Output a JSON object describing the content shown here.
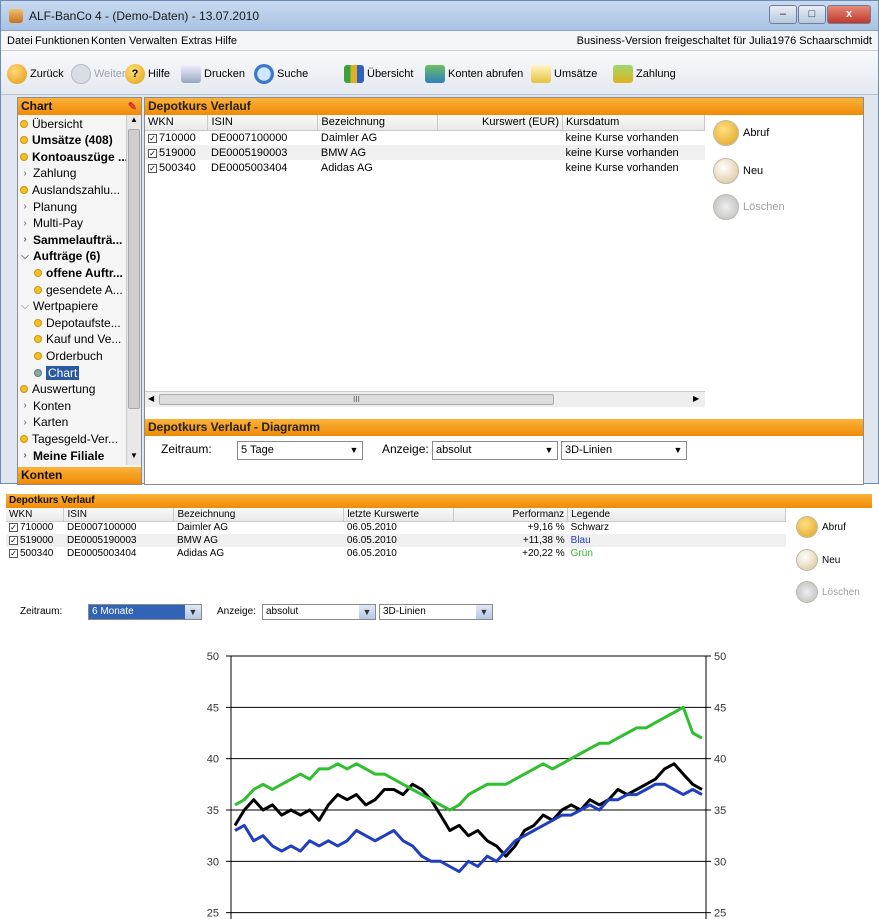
{
  "window": {
    "title": "ALF-BanCo 4 - (Demo-Daten)  -  13.07.2010",
    "controls": {
      "minimize": "–",
      "maximize": "□",
      "close": "x"
    }
  },
  "menu": {
    "items": [
      "Datei",
      "Funktionen",
      "Konten",
      "Verwalten",
      "Extras",
      "Hilfe"
    ],
    "status": "Business-Version freigeschaltet für Julia1976 Schaarschmidt"
  },
  "toolbar": {
    "back": "Zurück",
    "forward": "Weiter",
    "help": "Hilfe",
    "print": "Drucken",
    "search": "Suche",
    "overview": "Übersicht",
    "fetch_accounts": "Konten abrufen",
    "transactions": "Umsätze",
    "payment": "Zahlung"
  },
  "sidebar": {
    "header": "Chart",
    "items": [
      {
        "label": "Übersicht",
        "kind": "dot"
      },
      {
        "label": "Umsätze (408)",
        "kind": "dot",
        "bold": true
      },
      {
        "label": "Kontoauszüge ...",
        "kind": "dot",
        "bold": true
      },
      {
        "label": "Zahlung",
        "kind": "chev"
      },
      {
        "label": "Auslandszahlu...",
        "kind": "dot"
      },
      {
        "label": "Planung",
        "kind": "chev"
      },
      {
        "label": "Multi-Pay",
        "kind": "chev"
      },
      {
        "label": "Sammelaufträ...",
        "kind": "chev",
        "bold": true
      },
      {
        "label": "Aufträge (6)",
        "kind": "open",
        "bold": true
      },
      {
        "label": "offene Auftr...",
        "kind": "dot",
        "bold": true,
        "indent": true
      },
      {
        "label": "gesendete A...",
        "kind": "dot",
        "indent": true
      },
      {
        "label": "Wertpapiere",
        "kind": "open"
      },
      {
        "label": "Depotaufste...",
        "kind": "dot",
        "indent": true
      },
      {
        "label": "Kauf und Ve...",
        "kind": "dot",
        "indent": true
      },
      {
        "label": "Orderbuch",
        "kind": "dot",
        "indent": true
      },
      {
        "label": "Chart",
        "kind": "grey",
        "indent": true,
        "selected": true
      },
      {
        "label": "Auswertung",
        "kind": "dot"
      },
      {
        "label": "Konten",
        "kind": "chev"
      },
      {
        "label": "Karten",
        "kind": "chev"
      },
      {
        "label": "Tagesgeld-Ver...",
        "kind": "dot"
      },
      {
        "label": "Meine Filiale",
        "kind": "chev",
        "bold": true
      }
    ],
    "footer": "Konten"
  },
  "top_panel": {
    "header": "Depotkurs Verlauf",
    "columns": [
      "WKN",
      "ISIN",
      "Bezeichnung",
      "Kurswert (EUR)",
      "Kursdatum"
    ],
    "rows": [
      {
        "wkn": "710000",
        "isin": "DE0007100000",
        "name": "Daimler AG",
        "value": "",
        "date": "keine Kurse vorhanden"
      },
      {
        "wkn": "519000",
        "isin": "DE0005190003",
        "name": "BMW AG",
        "value": "",
        "date": "keine Kurse vorhanden"
      },
      {
        "wkn": "500340",
        "isin": "DE0005003404",
        "name": "Adidas AG",
        "value": "",
        "date": "keine Kurse vorhanden"
      }
    ],
    "actions": {
      "fetch": "Abruf",
      "new": "Neu",
      "delete": "Löschen"
    },
    "hscroll_label": "III",
    "diagram_header": "Depotkurs Verlauf - Diagramm",
    "period_label": "Zeitraum:",
    "period_value": "5 Tage",
    "display_label": "Anzeige:",
    "display_value": "absolut",
    "style_value": "3D-Linien"
  },
  "bottom_panel": {
    "header": "Depotkurs Verlauf",
    "columns": [
      "WKN",
      "ISIN",
      "Bezeichnung",
      "letzte Kurswerte",
      "Performanz",
      "Legende"
    ],
    "rows": [
      {
        "wkn": "710000",
        "isin": "DE0007100000",
        "name": "Daimler AG",
        "last": "06.05.2010",
        "perf": "+9,16 %",
        "legend": "Schwarz",
        "legend_color": "#000000"
      },
      {
        "wkn": "519000",
        "isin": "DE0005190003",
        "name": "BMW AG",
        "last": "06.05.2010",
        "perf": "+11,38 %",
        "legend": "Blau",
        "legend_color": "#1f3fbf"
      },
      {
        "wkn": "500340",
        "isin": "DE0005003404",
        "name": "Adidas AG",
        "last": "06.05.2010",
        "perf": "+20,22 %",
        "legend": "Grün",
        "legend_color": "#2fbf2f"
      }
    ],
    "actions": {
      "fetch": "Abruf",
      "new": "Neu",
      "delete": "Löschen"
    },
    "period_label": "Zeitraum:",
    "period_value": "6 Monate",
    "display_label": "Anzeige:",
    "display_value": "absolut",
    "style_value": "3D-Linien"
  },
  "chart_data": {
    "type": "line",
    "title": "",
    "xlabel": "",
    "ylabel": "",
    "ylim": [
      20,
      50
    ],
    "yticks": [
      25,
      30,
      35,
      40,
      45,
      50
    ],
    "grid": true,
    "series": [
      {
        "name": "Schwarz",
        "color": "#000000",
        "values": [
          33.5,
          35.0,
          36.0,
          35.0,
          35.5,
          34.5,
          35.0,
          34.5,
          35.0,
          34.0,
          35.5,
          36.5,
          36.0,
          36.5,
          35.5,
          36.0,
          37.0,
          37.0,
          36.5,
          37.5,
          37.0,
          36.0,
          34.5,
          33.0,
          33.5,
          32.5,
          33.0,
          32.0,
          31.5,
          30.5,
          31.5,
          33.0,
          33.5,
          34.5,
          34.0,
          35.0,
          35.5,
          35.0,
          36.0,
          35.5,
          36.0,
          37.0,
          36.5,
          37.0,
          37.5,
          38.0,
          39.0,
          39.5,
          38.5,
          37.5,
          37.0
        ]
      },
      {
        "name": "Blau",
        "color": "#1f3fbf",
        "values": [
          33.0,
          33.5,
          32.0,
          32.5,
          31.5,
          31.0,
          31.5,
          31.0,
          32.0,
          31.5,
          32.0,
          31.5,
          32.0,
          33.0,
          32.5,
          32.0,
          32.5,
          33.0,
          32.0,
          31.5,
          30.5,
          30.0,
          30.0,
          29.5,
          29.0,
          30.0,
          29.5,
          30.5,
          30.0,
          31.0,
          32.0,
          32.5,
          33.0,
          33.5,
          34.0,
          34.5,
          34.5,
          35.0,
          35.5,
          35.0,
          36.0,
          36.0,
          36.5,
          36.5,
          37.0,
          37.5,
          37.5,
          37.0,
          36.5,
          37.0,
          36.5
        ]
      },
      {
        "name": "Grün",
        "color": "#2fbf2f",
        "values": [
          35.5,
          36.0,
          37.0,
          37.5,
          37.0,
          37.5,
          38.0,
          38.5,
          38.0,
          39.0,
          39.0,
          39.5,
          39.0,
          39.5,
          39.0,
          38.5,
          38.5,
          38.0,
          37.5,
          37.0,
          36.5,
          36.0,
          35.5,
          35.0,
          35.5,
          36.5,
          37.0,
          37.5,
          37.5,
          37.5,
          38.0,
          38.5,
          39.0,
          39.5,
          39.0,
          39.5,
          40.0,
          40.5,
          41.0,
          41.5,
          41.5,
          42.0,
          42.5,
          43.0,
          43.0,
          43.5,
          44.0,
          44.5,
          45.0,
          42.5,
          42.0
        ]
      }
    ]
  }
}
